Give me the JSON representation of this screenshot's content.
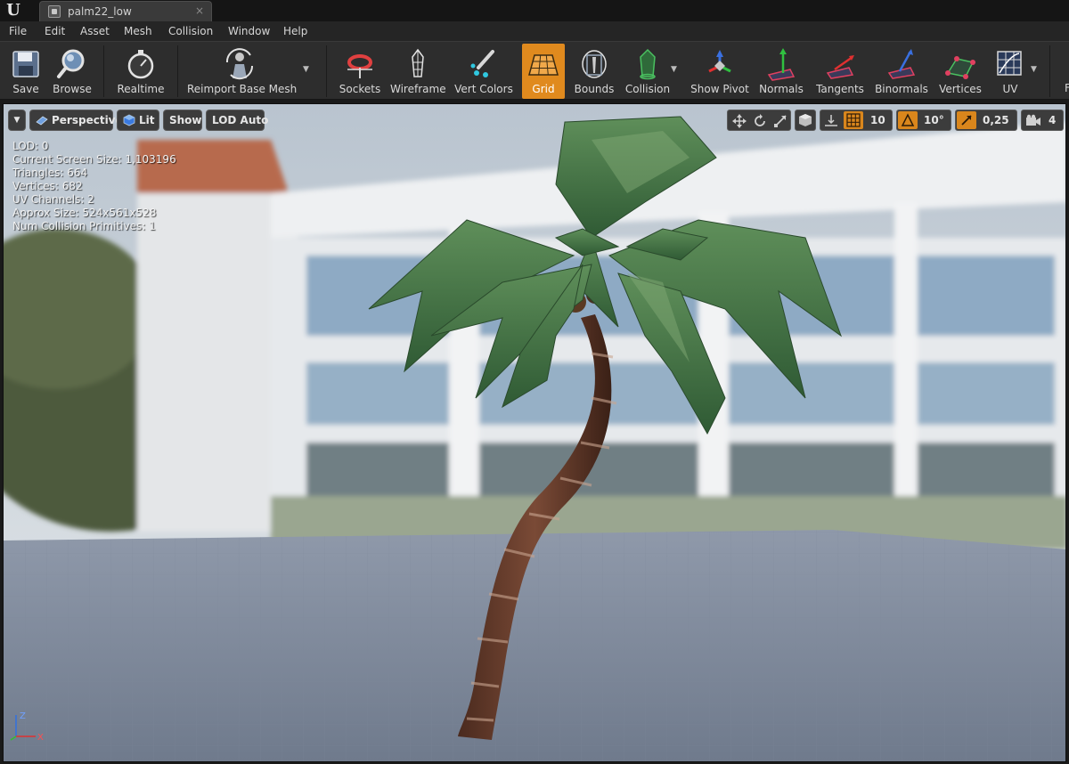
{
  "tab": {
    "title": "palm22_low",
    "close": "×"
  },
  "menu": [
    "File",
    "Edit",
    "Asset",
    "Mesh",
    "Collision",
    "Window",
    "Help"
  ],
  "toolbar": {
    "save": "Save",
    "browse": "Browse",
    "realtime": "Realtime",
    "reimport": "Reimport Base Mesh",
    "sockets": "Sockets",
    "wireframe": "Wireframe",
    "vert_colors": "Vert Colors",
    "grid": "Grid",
    "bounds": "Bounds",
    "collision": "Collision",
    "show_pivot": "Show Pivot",
    "normals": "Normals",
    "tangents": "Tangents",
    "binormals": "Binormals",
    "vertices": "Vertices",
    "uv": "UV",
    "overflow": "F",
    "active_color": "#e08a1e"
  },
  "viewport_toolbar": {
    "perspective": "Perspective",
    "lit": "Lit",
    "show": "Show",
    "lod": "LOD Auto",
    "grid_snap": "10",
    "rotation_snap": "10°",
    "scale_snap": "0,25",
    "camera_speed": "4"
  },
  "stats": [
    "LOD:  0",
    "Current Screen Size:  1,103196",
    "Triangles:  664",
    "Vertices:  682",
    "UV Channels:  2",
    "Approx Size: 524x561x528",
    "Num Collision Primitives:  1"
  ],
  "axis": {
    "z": "Z",
    "x": "X"
  },
  "colors": {
    "accent": "#e08a1e",
    "background": "#2d2d2d",
    "axis_x": "#e03030",
    "axis_y": "#30c030",
    "axis_z": "#3070e0"
  }
}
